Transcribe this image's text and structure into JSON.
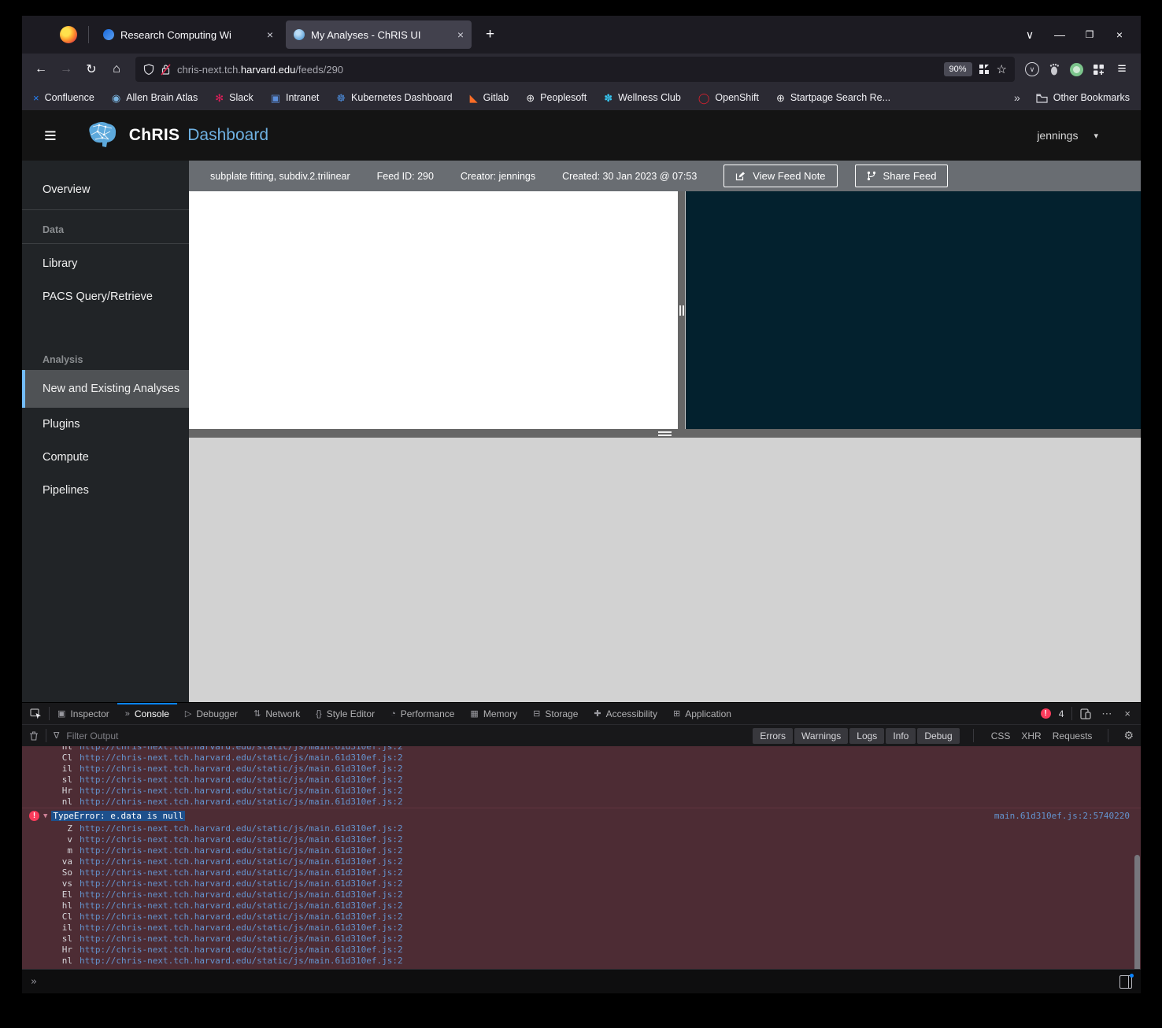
{
  "colors": {
    "accent_blue": "#0a84ff",
    "error_red": "#fb3b5b",
    "selection_blue": "#1e508c",
    "console_link_blue": "#6494cf",
    "brand_blue": "#6fb1e2",
    "error_row_bg": "#4d2c34",
    "sidebar_selected_accent": "#73bcf7"
  },
  "browser": {
    "tabs": [
      {
        "title": "Research Computing Wi",
        "close_glyph": "×"
      },
      {
        "title": "My Analyses - ChRIS UI",
        "close_glyph": "×",
        "active": true
      }
    ],
    "new_tab_glyph": "+",
    "window_controls": {
      "list_tabs": "∨",
      "minimize": "—",
      "maximize": "❐",
      "close": "×"
    },
    "nav": {
      "back": "←",
      "forward": "→",
      "reload": "↻",
      "home": "⌂"
    },
    "urlbar": {
      "host_prefix": "chris-next.tch.",
      "host_emph": "harvard.edu",
      "path": "/feeds/290",
      "zoom_badge": "90%",
      "bookmark_star": "☆"
    },
    "menu_glyph": "≡",
    "pocket_glyph": "∨",
    "bookmarks": [
      {
        "label": "Confluence",
        "glyph": "×",
        "color": "#2580f7"
      },
      {
        "label": "Allen Brain Atlas",
        "glyph": "◉",
        "color": "#7ab4e0"
      },
      {
        "label": "Slack",
        "glyph": "✻",
        "color": "#e01e5a"
      },
      {
        "label": "Intranet",
        "glyph": "▣",
        "color": "#5b8dd9"
      },
      {
        "label": "Kubernetes Dashboard",
        "glyph": "☸",
        "color": "#4d8fe0"
      },
      {
        "label": "Gitlab",
        "glyph": "◣",
        "color": "#fc6d26"
      },
      {
        "label": "Peoplesoft",
        "glyph": "⊕",
        "color": "#e8e8ea"
      },
      {
        "label": "Wellness Club",
        "glyph": "✽",
        "color": "#36c5f0"
      },
      {
        "label": "OpenShift",
        "glyph": "◯",
        "color": "#db212e"
      },
      {
        "label": "Startpage Search Re...",
        "glyph": "⊕",
        "color": "#e8e8ea"
      }
    ],
    "bookmarks_overflow_glyph": "»",
    "other_bookmarks_label": "Other Bookmarks"
  },
  "app": {
    "menu_glyph": "≡",
    "brand": "ChRIS",
    "brand_suffix": "Dashboard",
    "user": "jennings",
    "user_caret": "▾",
    "sidebar": {
      "overview": "Overview",
      "data_section": "Data",
      "library": "Library",
      "pacs": "PACS Query/Retrieve",
      "analysis_section": "Analysis",
      "new_existing": "New and Existing Analyses",
      "plugins": "Plugins",
      "compute": "Compute",
      "pipelines": "Pipelines"
    },
    "feed_bar": {
      "title": "subplate fitting, subdiv.2.trilinear",
      "feed_id": "Feed ID: 290",
      "creator": "Creator: jennings",
      "created": "Created: 30 Jan 2023 @ 07:53",
      "view_note_label": "View Feed Note",
      "share_label": "Share Feed"
    }
  },
  "devtools": {
    "tabs": [
      {
        "label": "Inspector",
        "glyph": "▣"
      },
      {
        "label": "Console",
        "glyph": "»",
        "active": true
      },
      {
        "label": "Debugger",
        "glyph": "▷"
      },
      {
        "label": "Network",
        "glyph": "⇅"
      },
      {
        "label": "Style Editor",
        "glyph": "{}"
      },
      {
        "label": "Performance",
        "glyph": "◔"
      },
      {
        "label": "Memory",
        "glyph": "▦"
      },
      {
        "label": "Storage",
        "glyph": "⊟"
      },
      {
        "label": "Accessibility",
        "glyph": "✚"
      },
      {
        "label": "Application",
        "glyph": "⊞"
      }
    ],
    "error_badge_glyph": "!",
    "error_count": "4",
    "meatball_glyph": "⋯",
    "close_glyph": "×",
    "filter": {
      "funnel_glyph": "∇",
      "placeholder": "Filter Output",
      "levels": [
        "Errors",
        "Warnings",
        "Logs",
        "Info",
        "Debug"
      ],
      "categories": [
        "CSS",
        "XHR",
        "Requests"
      ],
      "gear_glyph": "⚙"
    },
    "console": {
      "stack_url": "http://chris-next.tch.harvard.edu/static/js/main.61d310ef.js:2",
      "top_frames": [
        "hl",
        "Cl",
        "il",
        "sl",
        "Hr",
        "nl"
      ],
      "error_caret": "▼",
      "error_badge_glyph": "!",
      "error_message": "TypeError: e.data is null",
      "error_source": "main.61d310ef.js:2:5740220",
      "error_frames": [
        "Z",
        "v",
        "m",
        "va",
        "So",
        "vs",
        "El",
        "hl",
        "Cl",
        "il",
        "sl",
        "Hr",
        "nl"
      ],
      "input_prompt": "»"
    }
  }
}
